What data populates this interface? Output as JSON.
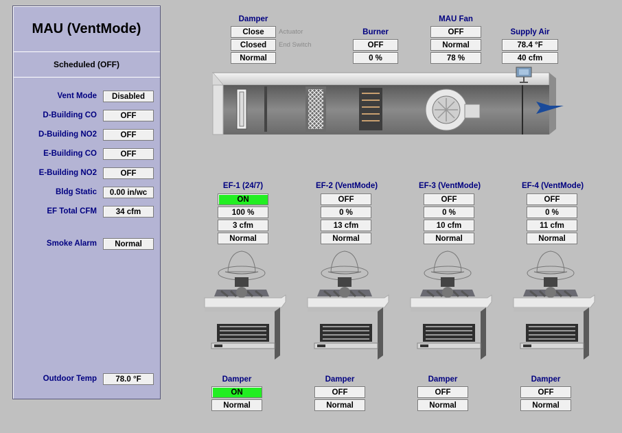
{
  "panel": {
    "title": "MAU (VentMode)",
    "subtitle": "Scheduled (OFF)",
    "rows": [
      {
        "label": "Vent Mode",
        "value": "Disabled"
      },
      {
        "label": "D-Building CO",
        "value": "OFF"
      },
      {
        "label": "D-Building NO2",
        "value": "OFF"
      },
      {
        "label": "E-Building CO",
        "value": "OFF"
      },
      {
        "label": "E-Building NO2",
        "value": "OFF"
      },
      {
        "label": "Bldg Static",
        "value": "0.00 in/wc"
      },
      {
        "label": "EF Total CFM",
        "value": "34 cfm"
      },
      {
        "label": "Smoke Alarm",
        "value": "Normal"
      },
      {
        "label": "Outdoor Temp",
        "value": "78.0 °F"
      }
    ]
  },
  "mau": {
    "damper": {
      "title": "Damper",
      "actuator": "Close",
      "actuator_note": "Actuator",
      "end_switch": "Closed",
      "end_switch_note": "End Switch",
      "status": "Normal"
    },
    "burner": {
      "title": "Burner",
      "state": "OFF",
      "output": "0 %"
    },
    "fan": {
      "title": "MAU Fan",
      "state": "OFF",
      "status": "Normal",
      "speed": "78 %"
    },
    "supply": {
      "title": "Supply Air",
      "temp": "78.4 °F",
      "flow": "40 cfm"
    }
  },
  "exhaust_fans": [
    {
      "title": "EF-1 (24/7)",
      "state": "ON",
      "speed": "100 %",
      "flow": "3 cfm",
      "status": "Normal",
      "damper_title": "Damper",
      "damper_state": "ON",
      "damper_status": "Normal",
      "on": true
    },
    {
      "title": "EF-2 (VentMode)",
      "state": "OFF",
      "speed": "0 %",
      "flow": "13 cfm",
      "status": "Normal",
      "damper_title": "Damper",
      "damper_state": "OFF",
      "damper_status": "Normal",
      "on": false
    },
    {
      "title": "EF-3 (VentMode)",
      "state": "OFF",
      "speed": "0 %",
      "flow": "10 cfm",
      "status": "Normal",
      "damper_title": "Damper",
      "damper_state": "OFF",
      "damper_status": "Normal",
      "on": false
    },
    {
      "title": "EF-4 (VentMode)",
      "state": "OFF",
      "speed": "0 %",
      "flow": "11 cfm",
      "status": "Normal",
      "damper_title": "Damper",
      "damper_state": "OFF",
      "damper_status": "Normal",
      "on": false
    }
  ],
  "colors": {
    "background": "#c0c0c0",
    "panel": "#b4b4d4",
    "label": "#000080",
    "on": "#22ee22"
  }
}
